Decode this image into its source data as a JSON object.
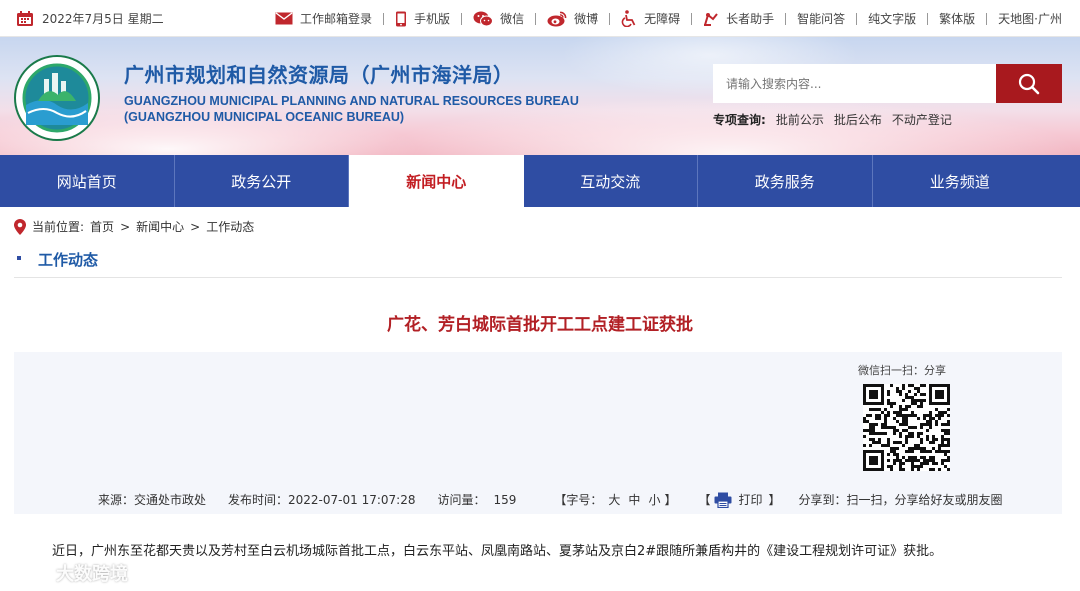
{
  "topbar": {
    "date": "2022年7月5日 星期二",
    "links": [
      {
        "label": "工作邮箱登录",
        "icon": "mail-icon"
      },
      {
        "label": "手机版",
        "icon": "mobile-icon"
      },
      {
        "label": "微信",
        "icon": "wechat-icon"
      },
      {
        "label": "微博",
        "icon": "weibo-icon"
      },
      {
        "label": "无障碍",
        "icon": "accessibility-icon"
      },
      {
        "label": "长者助手",
        "icon": "elder-helper-icon"
      },
      {
        "label": "智能问答"
      },
      {
        "label": "纯文字版"
      },
      {
        "label": "繁体版"
      },
      {
        "label": "天地图·广州"
      }
    ]
  },
  "header": {
    "title_cn": "广州市规划和自然资源局（广州市海洋局）",
    "title_en_1": "GUANGZHOU MUNICIPAL PLANNING AND NATURAL RESOURCES BUREAU",
    "title_en_2": "(GUANGZHOU MUNICIPAL OCEANIC BUREAU)",
    "search_placeholder": "请输入搜索内容...",
    "special_label": "专项查询:",
    "special_links": [
      "批前公示",
      "批后公布",
      "不动产登记"
    ]
  },
  "nav": {
    "items": [
      "网站首页",
      "政务公开",
      "新闻中心",
      "互动交流",
      "政务服务",
      "业务频道"
    ],
    "active": "新闻中心"
  },
  "breadcrumb": {
    "label": "当前位置:",
    "items": [
      "首页",
      "新闻中心",
      "工作动态"
    ],
    "separator": ">"
  },
  "section": {
    "title": "工作动态"
  },
  "article": {
    "title": "广花、芳白城际首批开工工点建工证获批",
    "qr_label": "微信扫一扫：分享",
    "meta": {
      "source": "来源：交通处市政处",
      "publish_time": "发布时间：2022-07-01 17:07:28",
      "views_label": "访问量：",
      "views": "159",
      "font_label": "【字号：",
      "font_large": "大",
      "font_medium": "中",
      "font_small": "小",
      "font_close": "】",
      "print_open": "【",
      "print_label": "打印",
      "print_close": "】",
      "share_label": "分享到：扫一扫，分享给好友或朋友圈"
    },
    "body": "近日，广州东至花都天贵以及芳村至白云机场城际首批工点，白云东平站、凤凰南路站、夏茅站及京白2#跟随所兼盾构井的《建设工程规划许可证》获批。"
  },
  "watermark": "大数跨境",
  "colors": {
    "nav_bg": "#2f4da3",
    "accent_red": "#a8191e",
    "title_blue": "#1f5aa6",
    "article_title_red": "#b22025"
  }
}
